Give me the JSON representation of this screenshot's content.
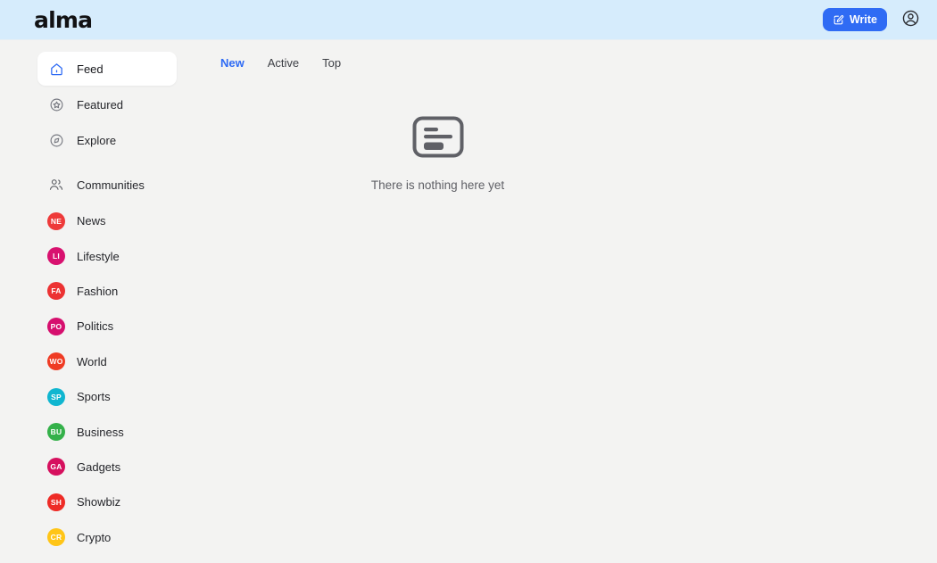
{
  "header": {
    "logo": "alma",
    "write_label": "Write",
    "write_icon": "edit-square-icon",
    "account_icon": "user-circle-icon",
    "accent_color": "#2f6bf4",
    "background_color": "#d6ecfc"
  },
  "sidebar": {
    "nav": [
      {
        "label": "Feed",
        "icon": "home-icon",
        "active": true
      },
      {
        "label": "Featured",
        "icon": "star-circle-icon",
        "active": false
      },
      {
        "label": "Explore",
        "icon": "compass-icon",
        "active": false
      }
    ],
    "communities": {
      "label": "Communities",
      "icon": "users-icon"
    },
    "topics": [
      {
        "label": "News",
        "initials": "NE",
        "color": "#ee3a3a"
      },
      {
        "label": "Lifestyle",
        "initials": "LI",
        "color": "#d8116f"
      },
      {
        "label": "Fashion",
        "initials": "FA",
        "color": "#ec3233"
      },
      {
        "label": "Politics",
        "initials": "PO",
        "color": "#d60f6e"
      },
      {
        "label": "World",
        "initials": "WO",
        "color": "#ef3b24"
      },
      {
        "label": "Sports",
        "initials": "SP",
        "color": "#10b6d0"
      },
      {
        "label": "Business",
        "initials": "BU",
        "color": "#34b14a"
      },
      {
        "label": "Gadgets",
        "initials": "GA",
        "color": "#d6105e"
      },
      {
        "label": "Showbiz",
        "initials": "SH",
        "color": "#ee2b26"
      },
      {
        "label": "Crypto",
        "initials": "CR",
        "color": "#ffc517"
      }
    ]
  },
  "main": {
    "tabs": [
      {
        "label": "New",
        "active": true
      },
      {
        "label": "Active",
        "active": false
      },
      {
        "label": "Top",
        "active": false
      }
    ],
    "empty": {
      "icon": "article-card-icon",
      "text": "There is nothing here yet"
    }
  }
}
